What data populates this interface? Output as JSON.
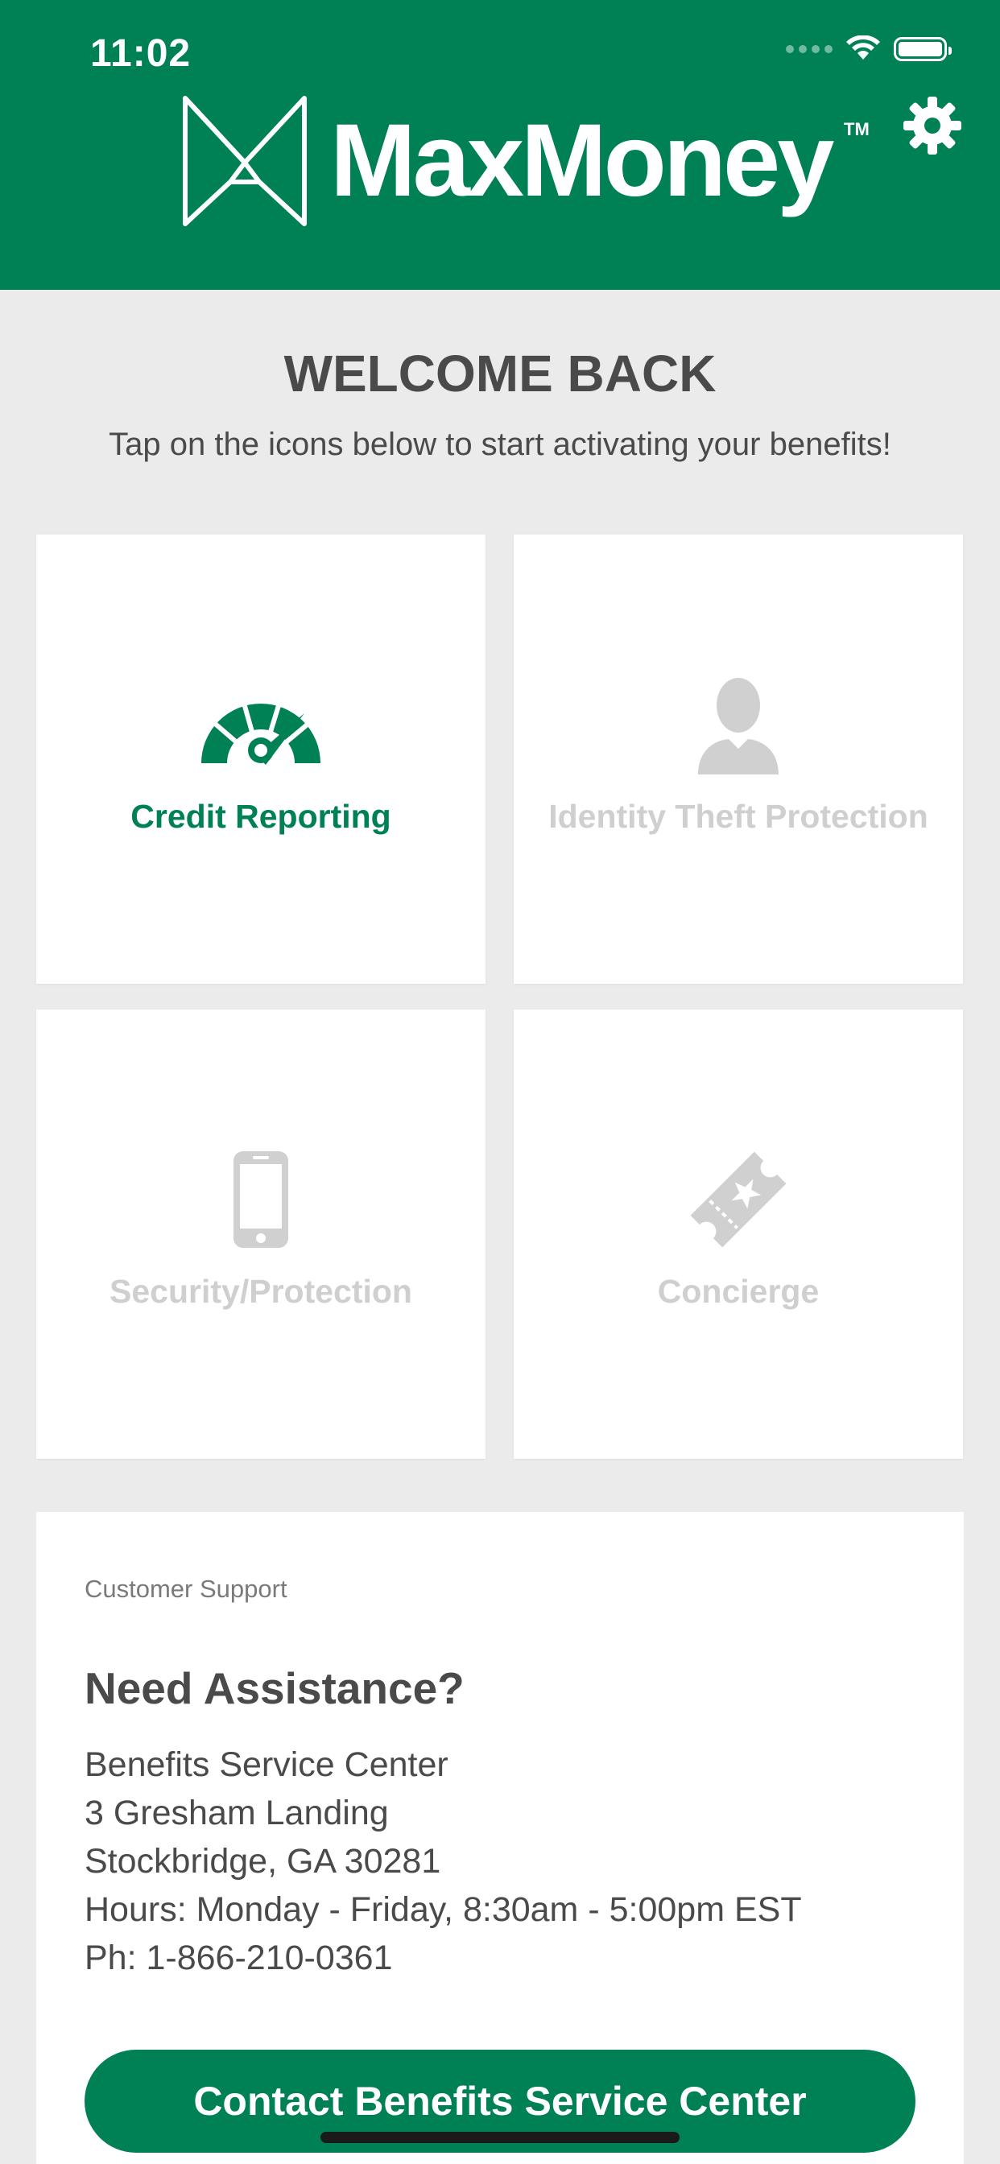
{
  "status_bar": {
    "time": "11:02"
  },
  "header": {
    "brand_name": "MaxMoney",
    "trademark": "TM",
    "brand_color": "#008055",
    "settings_icon": "gear-icon"
  },
  "welcome": {
    "title": "WELCOME BACK",
    "subtitle": "Tap on the icons below to start activating your benefits!"
  },
  "tiles": [
    {
      "label": "Credit Reporting",
      "icon": "speedometer-icon",
      "state": "active"
    },
    {
      "label": "Identity Theft Protection",
      "icon": "person-icon",
      "state": "disabled"
    },
    {
      "label": "Security/Protection",
      "icon": "smartphone-icon",
      "state": "disabled"
    },
    {
      "label": "Concierge",
      "icon": "ticket-icon",
      "state": "disabled"
    }
  ],
  "support": {
    "kicker": "Customer Support",
    "title": "Need Assistance?",
    "lines": [
      "Benefits Service Center",
      "3 Gresham Landing",
      "Stockbridge, GA 30281",
      "Hours: Monday - Friday, 8:30am - 5:00pm EST",
      "Ph: 1-866-210-0361"
    ],
    "button_label": "Contact Benefits Service Center"
  },
  "colors": {
    "accent": "#008055",
    "disabled": "#cfcfcf",
    "text": "#4a4a4a",
    "background": "#ebebeb"
  }
}
